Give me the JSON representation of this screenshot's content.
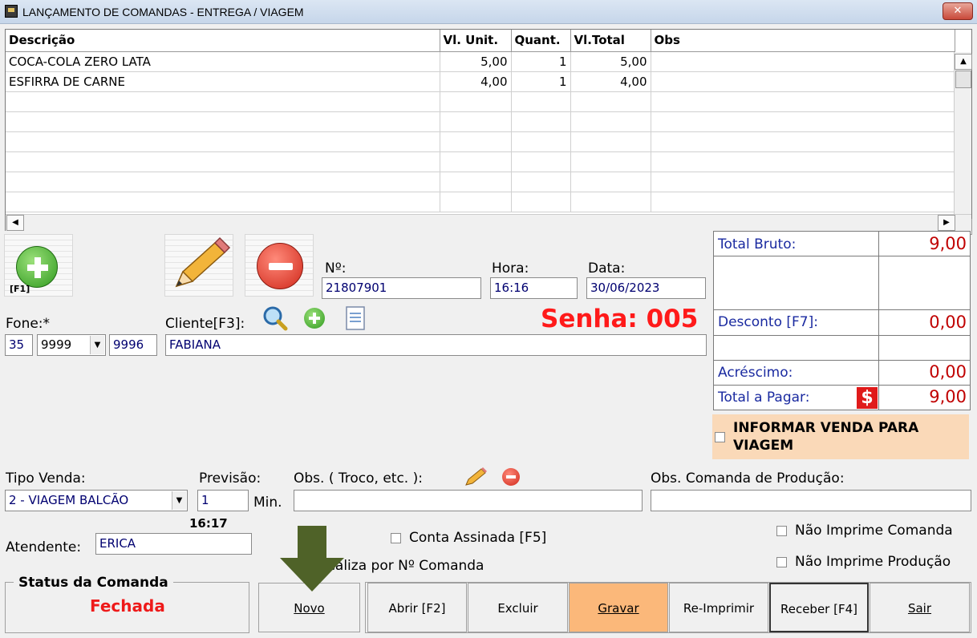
{
  "window": {
    "title": "LANÇAMENTO DE COMANDAS - ENTREGA / VIAGEM",
    "close_glyph": "✕"
  },
  "grid": {
    "columns": [
      "Descrição",
      "Vl. Unit.",
      "Quant.",
      "Vl.Total",
      "Obs"
    ],
    "rows": [
      [
        "COCA-COLA ZERO LATA",
        "5,00",
        "1",
        "5,00",
        ""
      ],
      [
        "ESFIRRA DE CARNE",
        "4,00",
        "1",
        "4,00",
        ""
      ]
    ]
  },
  "toolbar": {
    "add_hint": "[F1]"
  },
  "header": {
    "numero_label": "Nº:",
    "numero_value": "21807901",
    "hora_label": "Hora:",
    "hora_value": "16:16",
    "data_label": "Data:",
    "data_value": "30/06/2023",
    "senha": "Senha: 005"
  },
  "cliente": {
    "fone_label": "Fone:*",
    "ddd": "35",
    "prefixo": "9999",
    "sufixo": "9996",
    "cliente_label": "Cliente[F3]:",
    "cliente_value": "FABIANA"
  },
  "totals": {
    "bruto_label": "Total Bruto:",
    "bruto_value": "9,00",
    "desconto_label": "Desconto [F7]:",
    "desconto_value": "0,00",
    "acrescimo_label": "Acréscimo:",
    "acrescimo_value": "0,00",
    "pagar_label": "Total a Pagar:",
    "pagar_value": "9,00",
    "pagar_icon": "$"
  },
  "viagem": {
    "label": "INFORMAR VENDA PARA VIAGEM"
  },
  "venda": {
    "tipo_label": "Tipo Venda:",
    "tipo_value": "2 - VIAGEM BALCÃO",
    "previsao_label": "Previsão:",
    "previsao_value": "1",
    "min_label": "Min.",
    "previsao_time": "16:17",
    "obs_label": "Obs. ( Troco, etc. ):",
    "obs_value": "",
    "obs_producao_label": "Obs. Comanda de Produção:",
    "obs_producao_value": ""
  },
  "atendente": {
    "label": "Atendente:",
    "value": "ERICA"
  },
  "options": {
    "conta_assinada": "Conta Assinada [F5]",
    "localiza": "Localiza por Nº Comanda",
    "nao_imprime_comanda": "Não Imprime Comanda",
    "nao_imprime_producao": "Não Imprime Produção"
  },
  "status": {
    "title": "Status da Comanda",
    "value": "Fechada"
  },
  "buttons": {
    "novo": "Novo",
    "abrir": "Abrir [F2]",
    "excluir": "Excluir",
    "gravar": "Gravar",
    "reimprimir": "Re-Imprimir",
    "receber": "Receber [F4]",
    "sair": "Sair"
  },
  "colors": {
    "accent_red": "#c00000",
    "highlight": "#fbb87a",
    "arrow": "#4f6228"
  }
}
